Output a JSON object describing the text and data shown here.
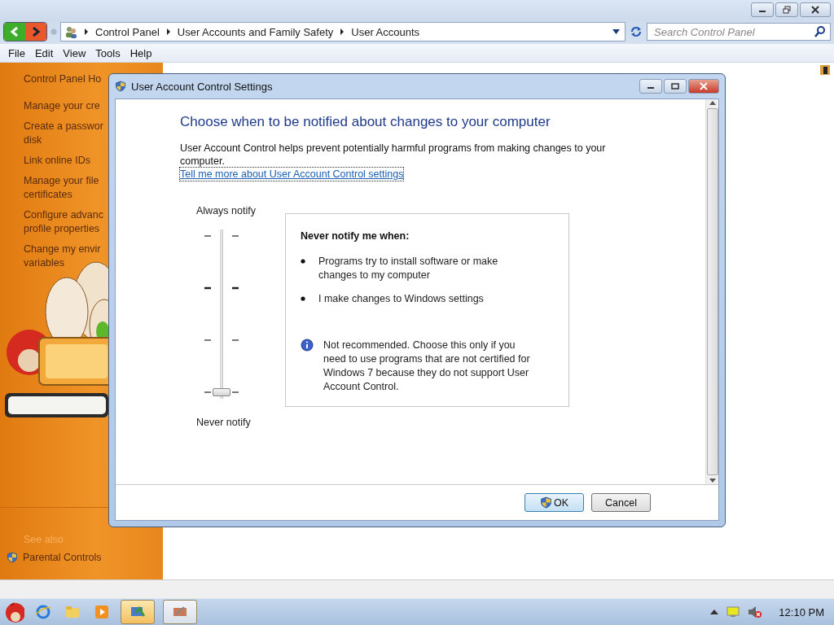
{
  "address_bar": {
    "breadcrumbs": [
      "Control Panel",
      "User Accounts and Family Safety",
      "User Accounts"
    ]
  },
  "search": {
    "placeholder": "Search Control Panel"
  },
  "menu": [
    "File",
    "Edit",
    "View",
    "Tools",
    "Help"
  ],
  "sidebar": {
    "items": [
      {
        "lines": [
          "Control Panel Ho"
        ]
      },
      {
        "lines": [
          "Manage your cre"
        ]
      },
      {
        "lines": [
          "Create a passwor",
          "disk"
        ]
      },
      {
        "lines": [
          "Link online IDs"
        ]
      },
      {
        "lines": [
          "Manage your file",
          "certificates"
        ]
      },
      {
        "lines": [
          "Configure advanc",
          "profile properties"
        ]
      },
      {
        "lines": [
          "Change my envir",
          "variables"
        ]
      }
    ],
    "see_also_heading": "See also",
    "see_also": [
      "Parental Controls"
    ]
  },
  "dialog": {
    "title": "User Account Control Settings",
    "heading": "Choose when to be notified about changes to your computer",
    "description": "User Account Control helps prevent potentially harmful programs from making changes to your computer.",
    "link": "Tell me more about User Account Control settings",
    "slider": {
      "top_label": "Always notify",
      "bottom_label": "Never notify",
      "level": 0
    },
    "info": {
      "heading": "Never notify me when:",
      "bullets": [
        "Programs try to install software or make changes to my computer",
        "I make changes to Windows settings"
      ],
      "note": "Not recommended. Choose this only if you need to use programs that are not certified for Windows 7 because they do not support User Account Control."
    },
    "buttons": [
      {
        "label": "OK",
        "kind": "shield"
      },
      {
        "label": "Cancel",
        "kind": "plain"
      }
    ]
  },
  "taskbar": {
    "clock": "12:10 PM"
  }
}
